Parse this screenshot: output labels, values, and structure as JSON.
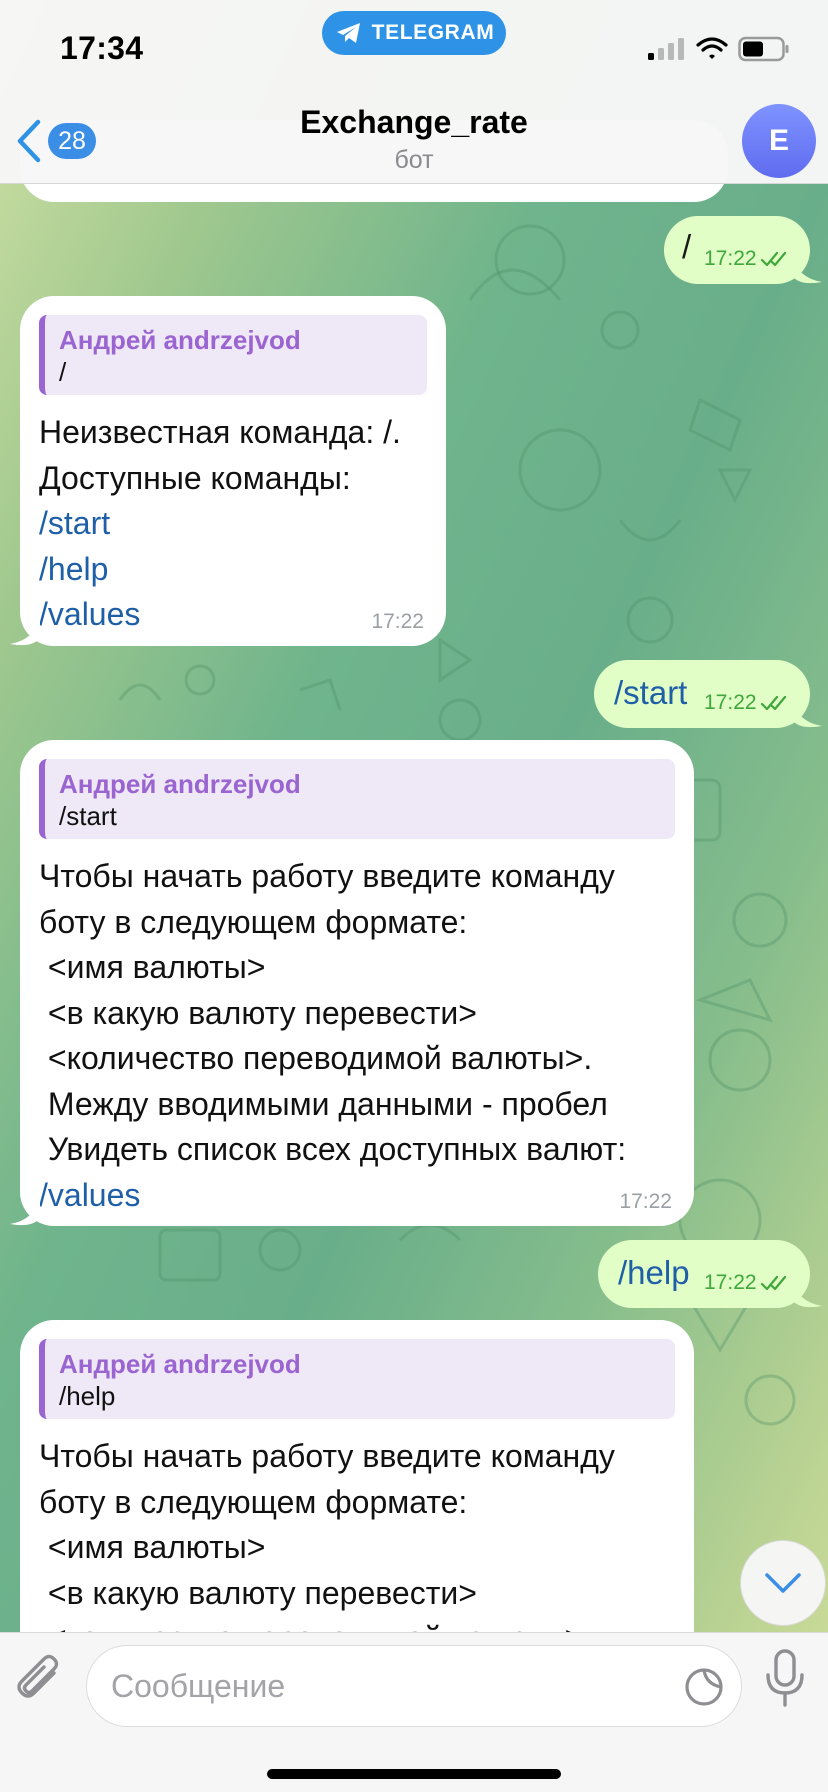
{
  "status_bar": {
    "time": "17:34",
    "app_pill": "TELEGRAM"
  },
  "header": {
    "back_count": "28",
    "title": "Exchange_rate",
    "subtitle": "бот",
    "avatar_letter": "E"
  },
  "messages": {
    "out1": {
      "text": "/",
      "time": "17:22"
    },
    "in1": {
      "reply_name": "Андрей andrzejvod",
      "reply_text": "/",
      "line1": "Неизвестная команда: /.",
      "line2": "Доступные команды:",
      "link1": "/start",
      "link2": "/help",
      "link3": "/values",
      "time": "17:22"
    },
    "out2": {
      "text": "/start",
      "time": "17:22"
    },
    "in2": {
      "reply_name": "Андрей andrzejvod",
      "reply_text": "/start",
      "line1": "Чтобы начать работу введите команду",
      "line2": "боту в следующем формате:",
      "line3": " <имя валюты>",
      "line4": " <в какую валюту перевести>",
      "line5": " <количество переводимой валюты>.",
      "line6": " Между вводимыми данными - пробел",
      "line7": " Увидеть список всех доступных валют:",
      "link1": "/values",
      "time": "17:22"
    },
    "out3": {
      "text": "/help",
      "time": "17:22"
    },
    "in3": {
      "reply_name": "Андрей andrzejvod",
      "reply_text": "/help",
      "line1": "Чтобы начать работу введите команду",
      "line2": "боту в следующем формате:",
      "line3": " <имя валюты>",
      "line4": " <в какую валюту перевести>",
      "line5": " <количество переводимой валюты>."
    }
  },
  "composer": {
    "placeholder": "Сообщение"
  },
  "icons": {
    "back": "chevron-left-icon",
    "attach": "paperclip-icon",
    "sticker": "sticker-icon",
    "mic": "microphone-icon",
    "scroll": "chevron-down-icon",
    "read": "double-check-icon"
  },
  "colors": {
    "accent": "#2e93e6",
    "outgoing_bubble": "#e1fec6",
    "incoming_bubble": "#ffffff",
    "link": "#1f5fa8",
    "reply_name": "#9a65d0",
    "read_check": "#3fa73b"
  }
}
